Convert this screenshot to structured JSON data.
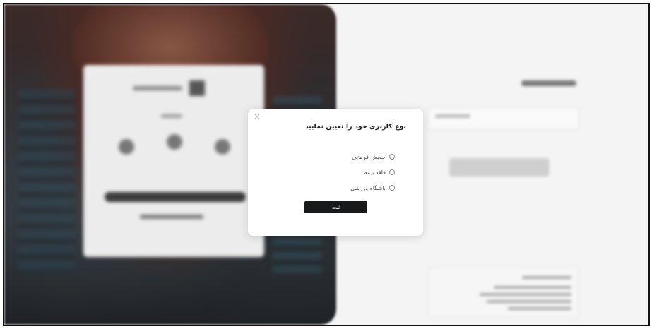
{
  "modal": {
    "title": "نوع کاربری خود را تعیین نمایید",
    "close_label": "×",
    "options": [
      {
        "label": "خویش فرمایی"
      },
      {
        "label": "فاقد بیمه"
      },
      {
        "label": "باشگاه ورزشی"
      }
    ],
    "submit_label": "ثبت"
  },
  "icons": {
    "close": "close-icon",
    "radio": "radio-unchecked-icon"
  },
  "colors": {
    "submit_bg": "#18191b",
    "overlay_bg": "#f4f4f4"
  }
}
